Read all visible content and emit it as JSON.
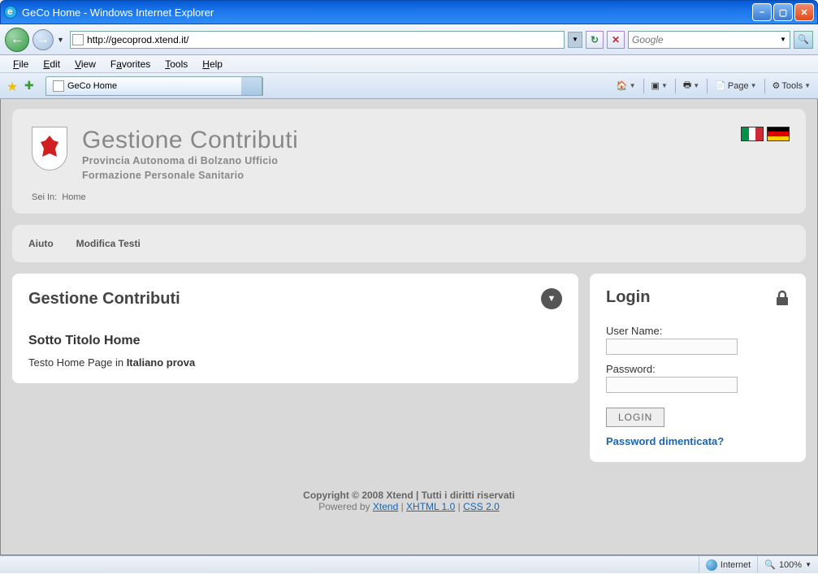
{
  "window": {
    "title": "GeCo Home - Windows Internet Explorer"
  },
  "address": {
    "url": "http://gecoprod.xtend.it/"
  },
  "search": {
    "placeholder": "Google"
  },
  "menu": {
    "file": "File",
    "edit": "Edit",
    "view": "View",
    "favorites": "Favorites",
    "tools": "Tools",
    "help": "Help"
  },
  "tabs": {
    "active": "GeCo Home"
  },
  "commandbar": {
    "page": "Page",
    "tools": "Tools"
  },
  "header": {
    "title": "Gestione Contributi",
    "sub1": "Provincia Autonoma di Bolzano Ufficio",
    "sub2": "Formazione Personale Sanitario"
  },
  "breadcrumb": {
    "label": "Sei In:",
    "item": "Home"
  },
  "nav": {
    "aiuto": "Aiuto",
    "modifica": "Modifica Testi"
  },
  "main": {
    "title": "Gestione Contributi",
    "subtitle": "Sotto Titolo Home",
    "text_prefix": "Testo Home Page in ",
    "text_bold": "Italiano prova"
  },
  "login": {
    "title": "Login",
    "username_label": "User Name:",
    "password_label": "Password:",
    "button": "LOGIN",
    "forgot": "Password dimenticata?"
  },
  "footer": {
    "copyright": "Copyright © 2008 Xtend  |  Tutti i diritti riservati",
    "powered": "Powered by ",
    "link1": "Xtend",
    "link2": "XHTML 1.0",
    "link3": "CSS 2.0"
  },
  "status": {
    "zone": "Internet",
    "zoom": "100%"
  }
}
